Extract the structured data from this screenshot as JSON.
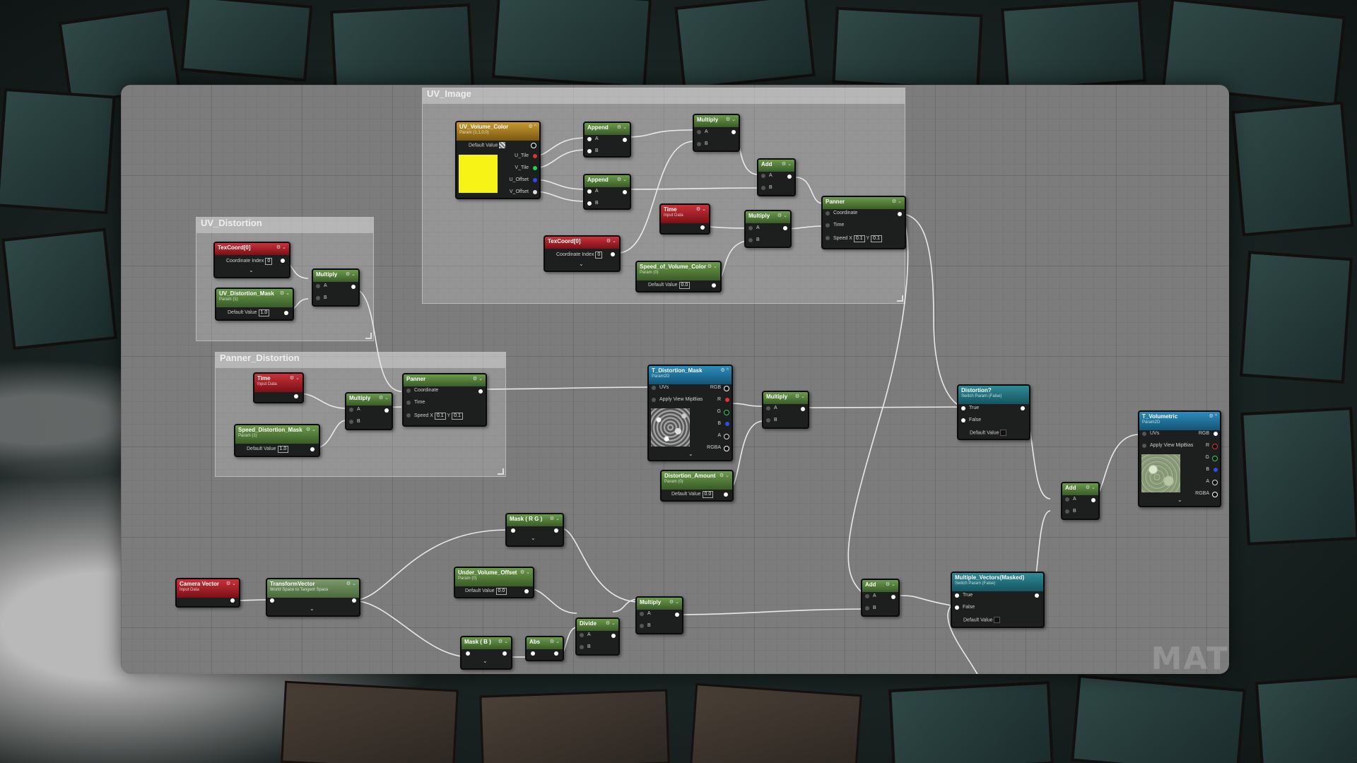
{
  "watermark": "MAT",
  "comments": {
    "uv_image": "UV_Image",
    "uv_distortion": "UV_Distortion",
    "panner_distortion": "Panner_Distortion"
  },
  "nodes": {
    "uv_volume_color": {
      "title": "UV_Volume_Color",
      "sub": "Param (1,1,0,0)",
      "default_label": "Default Value",
      "pins": [
        "U_Tile",
        "V_Tile",
        "U_Offset",
        "V_Offset"
      ],
      "swatch_color": "#f8f316"
    },
    "append_1": {
      "title": "Append",
      "a": "A",
      "b": "B"
    },
    "append_2": {
      "title": "Append",
      "a": "A",
      "b": "B"
    },
    "multiply_top": {
      "title": "Multiply",
      "a": "A",
      "b": "B"
    },
    "add_top": {
      "title": "Add",
      "a": "A",
      "b": "B"
    },
    "time_top": {
      "title": "Time",
      "sub": "Input Data"
    },
    "multiply_mid": {
      "title": "Multiply",
      "a": "A",
      "b": "B"
    },
    "texcoord_top": {
      "title": "TexCoord[0]",
      "label": "Coordinate Index",
      "value": "0"
    },
    "speed_volume_color": {
      "title": "Speed_of_Volume_Color",
      "sub": "Param (0)",
      "label": "Default Value",
      "value": "0.0"
    },
    "panner_top": {
      "title": "Panner",
      "coord": "Coordinate",
      "time": "Time",
      "speed": "Speed",
      "x_label": "X",
      "x": "0.1",
      "y_label": "Y",
      "y": "0.1"
    },
    "texcoord_dist": {
      "title": "TexCoord[0]",
      "label": "Coordinate Index",
      "value": "0"
    },
    "uv_distortion_mask": {
      "title": "UV_Distortion_Mask",
      "sub": "Param (1)",
      "label": "Default Value",
      "value": "1.0"
    },
    "multiply_dist": {
      "title": "Multiply",
      "a": "A",
      "b": "B"
    },
    "time_pan": {
      "title": "Time",
      "sub": "Input Data"
    },
    "multiply_pan": {
      "title": "Multiply",
      "a": "A",
      "b": "B"
    },
    "speed_distortion_mask": {
      "title": "Speed_Distortion_Mask",
      "sub": "Param (1)",
      "label": "Default Value",
      "value": "1.0"
    },
    "panner_pan": {
      "title": "Panner",
      "coord": "Coordinate",
      "time": "Time",
      "speed": "Speed",
      "x_label": "X",
      "x": "0.1",
      "y_label": "Y",
      "y": "0.1"
    },
    "t_distortion_mask": {
      "title": "T_Distortion_Mask",
      "sub": "Param2D",
      "uvs": "UVs",
      "rgb": "RGB",
      "mip": "Apply View MipBias",
      "r": "R",
      "g": "G",
      "b": "B",
      "a": "A",
      "rgba": "RGBA"
    },
    "distortion_amount": {
      "title": "Distortion_Amount",
      "sub": "Param (0)",
      "label": "Default Value",
      "value": "0.0"
    },
    "multiply_right": {
      "title": "Multiply",
      "a": "A",
      "b": "B"
    },
    "distortion_switch": {
      "title": "Distortion?",
      "sub": "Switch Param (False)",
      "t": "True",
      "f": "False",
      "label": "Default Value"
    },
    "add_right": {
      "title": "Add",
      "a": "A",
      "b": "B"
    },
    "t_volumetric": {
      "title": "T_Volumetric",
      "sub": "Param2D",
      "uvs": "UVs",
      "rgb": "RGB",
      "mip": "Apply View MipBias",
      "r": "R",
      "g": "G",
      "b": "B",
      "a": "A",
      "rgba": "RGBA"
    },
    "mask_rg": {
      "title": "Mask ( R G )"
    },
    "camera_vector": {
      "title": "Camera Vector",
      "sub": "Input Data"
    },
    "transform_vector": {
      "title": "TransformVector",
      "sub": "World Space to Tangent Space"
    },
    "under_volume_offset": {
      "title": "Under_Volume_Offset",
      "sub": "Param (0)",
      "label": "Default Value",
      "value": "0.0"
    },
    "multiply_bottom": {
      "title": "Multiply",
      "a": "A",
      "b": "B"
    },
    "divide": {
      "title": "Divide",
      "a": "A",
      "b": "B"
    },
    "mask_b": {
      "title": "Mask ( B )"
    },
    "abs": {
      "title": "Abs"
    },
    "add_bottom": {
      "title": "Add",
      "a": "A",
      "b": "B"
    },
    "multiple_vectors": {
      "title": "Multiple_Vectors(Masked)",
      "sub": "Switch Param (False)",
      "t": "True",
      "f": "False",
      "label": "Default Value"
    }
  }
}
